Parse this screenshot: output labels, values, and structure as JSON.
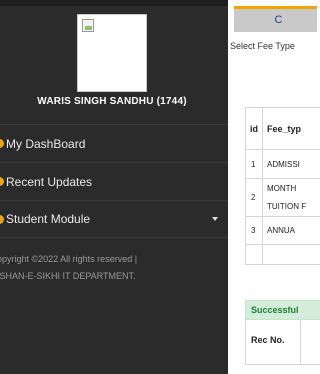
{
  "sidebar": {
    "profile_name": "WARIS SINGH SANDHU (1744)",
    "menu": [
      {
        "label": "My DashBoard",
        "icon": "dashboard-icon"
      },
      {
        "label": "Recent Updates",
        "icon": "updates-icon"
      },
      {
        "label": "Student Module",
        "icon": "student-icon",
        "has_caret": true
      }
    ],
    "footer_line1": "opyright ©2022 All rights reserved |",
    "footer_line2": "ISHAN-E-SIKHI IT DEPARTMENT."
  },
  "main": {
    "title": "C",
    "select_label": "Select Fee Type",
    "fee_table": {
      "headers": [
        "id",
        "Fee_typ"
      ],
      "rows": [
        {
          "id": "1",
          "fee": "ADMISSI"
        },
        {
          "id": "2",
          "fee_line1": "MONTH",
          "fee_line2": "TUITION F"
        },
        {
          "id": "3",
          "fee": "ANNUA"
        },
        {
          "id": "",
          "fee": ""
        }
      ]
    },
    "success_table": {
      "header": "Successful",
      "column": "Rec No."
    }
  },
  "colors": {
    "sidebar_bg": "#2b2b2b",
    "accent": "#f0a500",
    "success_bg": "#d4edda",
    "success_text": "#1e7e34"
  }
}
